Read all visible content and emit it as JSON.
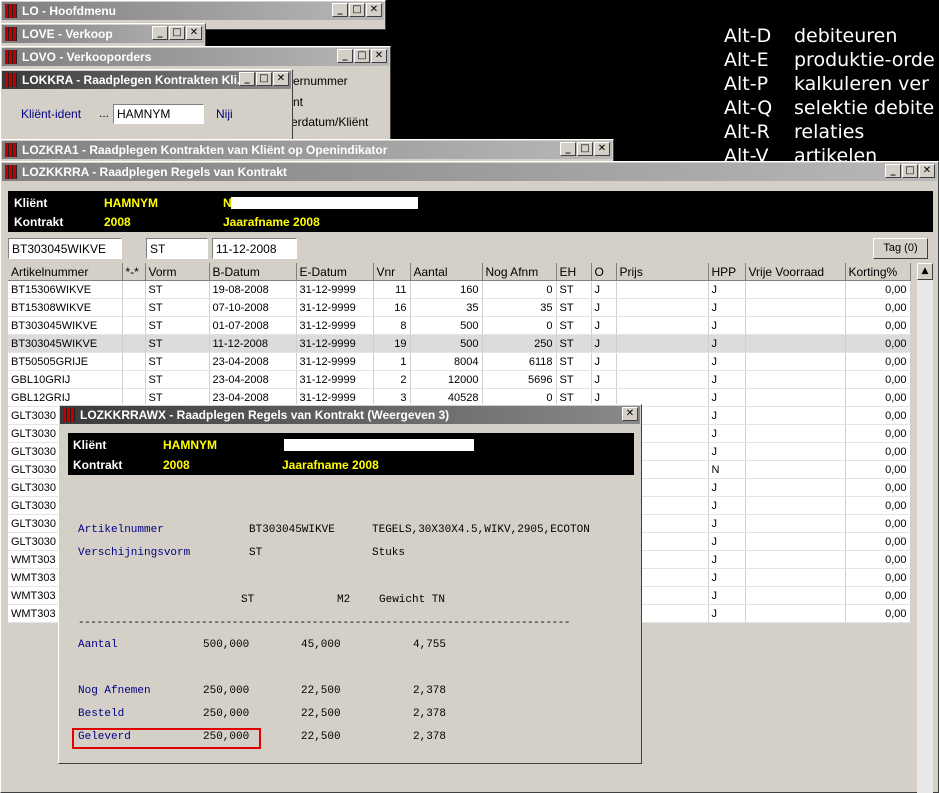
{
  "shortcuts": [
    {
      "key": "Alt-D",
      "label": "debiteuren"
    },
    {
      "key": "Alt-E",
      "label": "produktie-orde"
    },
    {
      "key": "Alt-P",
      "label": "kalkuleren ver"
    },
    {
      "key": "Alt-Q",
      "label": "selektie debite"
    },
    {
      "key": "Alt-R",
      "label": "relaties"
    },
    {
      "key": "Alt-V",
      "label": "artikelen"
    }
  ],
  "windows": {
    "lo": {
      "title": "LO - Hoofdmenu"
    },
    "love": {
      "title": "LOVE - Verkoop"
    },
    "lovo": {
      "title": "LOVO - Verkooporders",
      "labels": [
        "ernummer",
        "nt",
        "erdatum/Kliënt"
      ]
    },
    "lokkra": {
      "title": "LOKKRA - Raadplegen Kontrakten Kli...",
      "client_label": "Kliënt-ident",
      "client_value": "HAMNYM",
      "niji": "Niji"
    },
    "lozkra1": {
      "title": "LOZKRA1 - Raadplegen Kontrakten van Kliënt op Openindikator"
    }
  },
  "main": {
    "title": "LOZKKRRA - Raadplegen Regels van Kontrakt",
    "client_label": "Kliënt",
    "client_value": "HAMNYM",
    "client_name_initial": "N",
    "contract_label": "Kontrakt",
    "contract_value": "2008",
    "contract_name": "Jaarafname 2008",
    "filter_article": "BT303045WIKVE",
    "filter_form": "ST",
    "filter_date": "11-12-2008",
    "tag_button": "Tag (0)",
    "columns": [
      "Artikelnummer",
      "*-*",
      "Vorm",
      "B-Datum",
      "E-Datum",
      "Vnr",
      "Aantal",
      "Nog Afnm",
      "EH",
      "O",
      "Prijs",
      "HPP",
      "Vrije Voorraad",
      "Korting%"
    ],
    "rows": [
      [
        "BT15306WIKVE",
        "",
        "ST",
        "19-08-2008",
        "31-12-9999",
        "11",
        "160",
        "0",
        "ST",
        "J",
        "",
        "J",
        "",
        "0,00"
      ],
      [
        "BT15308WIKVE",
        "",
        "ST",
        "07-10-2008",
        "31-12-9999",
        "16",
        "35",
        "35",
        "ST",
        "J",
        "",
        "J",
        "",
        "0,00"
      ],
      [
        "BT303045WIKVE",
        "",
        "ST",
        "01-07-2008",
        "31-12-9999",
        "8",
        "500",
        "0",
        "ST",
        "J",
        "",
        "J",
        "",
        "0,00"
      ],
      [
        "BT303045WIKVE",
        "",
        "ST",
        "11-12-2008",
        "31-12-9999",
        "19",
        "500",
        "250",
        "ST",
        "J",
        "",
        "J",
        "",
        "0,00"
      ],
      [
        "BT50505GRIJE",
        "",
        "ST",
        "23-04-2008",
        "31-12-9999",
        "1",
        "8004",
        "6118",
        "ST",
        "J",
        "",
        "J",
        "",
        "0,00"
      ],
      [
        "GBL10GRIJ",
        "",
        "ST",
        "23-04-2008",
        "31-12-9999",
        "2",
        "12000",
        "5696",
        "ST",
        "J",
        "",
        "J",
        "",
        "0,00"
      ],
      [
        "GBL12GRIJ",
        "",
        "ST",
        "23-04-2008",
        "31-12-9999",
        "3",
        "40528",
        "0",
        "ST",
        "J",
        "",
        "J",
        "",
        "0,00"
      ],
      [
        "GLT3030",
        "",
        "",
        "",
        "",
        "",
        "",
        "",
        "",
        "",
        "",
        "J",
        "",
        "0,00"
      ],
      [
        "GLT3030",
        "",
        "",
        "",
        "",
        "",
        "",
        "",
        "",
        "",
        "",
        "J",
        "",
        "0,00"
      ],
      [
        "GLT3030",
        "",
        "",
        "",
        "",
        "",
        "",
        "",
        "",
        "",
        "",
        "J",
        "",
        "0,00"
      ],
      [
        "GLT3030",
        "",
        "",
        "",
        "",
        "",
        "",
        "",
        "",
        "",
        "",
        "N",
        "",
        "0,00"
      ],
      [
        "GLT3030",
        "",
        "",
        "",
        "",
        "",
        "",
        "",
        "",
        "",
        "",
        "J",
        "",
        "0,00"
      ],
      [
        "GLT3030",
        "",
        "",
        "",
        "",
        "",
        "",
        "",
        "",
        "",
        "",
        "J",
        "",
        "0,00"
      ],
      [
        "GLT3030",
        "",
        "",
        "",
        "",
        "",
        "",
        "",
        "",
        "",
        "",
        "J",
        "",
        "0,00"
      ],
      [
        "GLT3030",
        "",
        "",
        "",
        "",
        "",
        "",
        "",
        "",
        "",
        "",
        "J",
        "",
        "0,00"
      ],
      [
        "WMT303",
        "",
        "",
        "",
        "",
        "",
        "",
        "",
        "",
        "",
        "",
        "J",
        "",
        "0,00"
      ],
      [
        "WMT303",
        "",
        "",
        "",
        "",
        "",
        "",
        "",
        "",
        "",
        "",
        "J",
        "",
        "0,00"
      ],
      [
        "WMT303",
        "",
        "",
        "",
        "",
        "",
        "",
        "",
        "",
        "",
        "",
        "J",
        "",
        "0,00"
      ],
      [
        "WMT303",
        "",
        "",
        "",
        "",
        "",
        "",
        "",
        "",
        "",
        "",
        "J",
        "",
        "0,00"
      ]
    ],
    "selected_row": 3
  },
  "detail": {
    "title": "LOZKKRRAWX - Raadplegen Regels van Kontrakt (Weergeven 3)",
    "client_label": "Kliënt",
    "client_value": "HAMNYM",
    "contract_label": "Kontrakt",
    "contract_value": "2008",
    "contract_name": "Jaarafname 2008",
    "article_label": "Artikelnummer",
    "article_value": "BT303045WIKVE",
    "article_desc": "TEGELS,30X30X4.5,WIKV,2905,ECOTON",
    "form_label": "Verschijningsvorm",
    "form_value": "ST",
    "form_desc": "Stuks",
    "col_st": "ST",
    "col_m2": "M2",
    "col_weight": "Gewicht TN",
    "separator": "--------------------------------------------------------------------------------",
    "rows": [
      {
        "label": "Aantal",
        "st": "500,000",
        "m2": "45,000",
        "weight": "4,755"
      },
      {
        "label": "Nog Afnemen",
        "st": "250,000",
        "m2": "22,500",
        "weight": "2,378"
      },
      {
        "label": "Besteld",
        "st": "250,000",
        "m2": "22,500",
        "weight": "2,378"
      },
      {
        "label": "Geleverd",
        "st": "250,000",
        "m2": "22,500",
        "weight": "2,378"
      }
    ],
    "highlight_color": "#e00000"
  }
}
